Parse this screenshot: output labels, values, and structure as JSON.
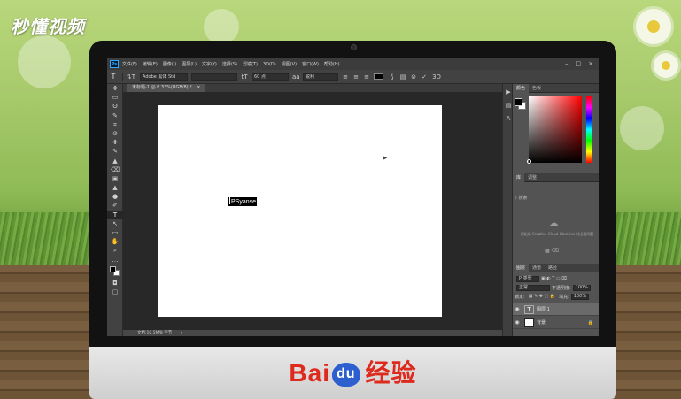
{
  "brand": {
    "watermark": "秒懂视频",
    "footer_logo_a": "Bai",
    "footer_logo_b": "du",
    "footer_logo_c": "经验"
  },
  "ps": {
    "logo": "Ps",
    "menu": [
      "文件(F)",
      "编辑(E)",
      "图像(I)",
      "图层(L)",
      "文字(Y)",
      "选择(S)",
      "滤镜(T)",
      "3D(D)",
      "视图(V)",
      "窗口(W)",
      "帮助(H)"
    ],
    "window_controls": [
      "–",
      "□",
      "×"
    ],
    "options": {
      "tool_icon": "T",
      "orient_icon": "⇅T",
      "font_family": "Adobe 黑体 Std",
      "font_style": "",
      "size_icon": "tT",
      "font_size": "60 点",
      "aa_icon": "aa",
      "aa_mode": "锐利",
      "align_icons": [
        "≡",
        "≡",
        "≡"
      ],
      "color": "#000000",
      "extra_icons": [
        "⟆",
        "▤",
        "⊘",
        "✓",
        "3D"
      ]
    },
    "doc_tab": "未标题-1 @ 8.33%(RGB/8) *",
    "doc_tab_close": "×",
    "text_layer_content": "PSyanse",
    "status_text": "文档:10.5M/8 字节",
    "status_arrow": "›",
    "tools": [
      "✥",
      "▭",
      "ʘ",
      "✎",
      "⌗",
      "⊘",
      "✚",
      "✎",
      "▲",
      "⌫",
      "▣",
      "▲",
      "●",
      "✐",
      "T",
      "↖",
      "▭",
      "✋",
      "⌕",
      "…"
    ],
    "panels": {
      "color_tabs": [
        "颜色",
        "色板"
      ],
      "library_tabs": [
        "库",
        "调整"
      ],
      "library_search": "搜索",
      "library_message": "初始化 Creative Cloud Libraries 时出现问题",
      "library_footer": "▦ ⌫",
      "layers_tabs": [
        "图层",
        "通道",
        "路径"
      ],
      "layers_kind": "P 类型",
      "blend_mode": "正常",
      "opacity_label": "不透明度:",
      "opacity_value": "100%",
      "lock_label": "锁定:",
      "fill_label": "填充:",
      "fill_value": "100%",
      "layers": [
        {
          "name": "图层 1",
          "thumb": "T",
          "selected": true
        },
        {
          "name": "背景",
          "thumb": "",
          "selected": false,
          "locked": true
        }
      ],
      "layers_footer": [
        "⊕",
        "fx",
        "◐",
        "◑",
        "▭",
        "▣",
        "⌫"
      ]
    }
  }
}
